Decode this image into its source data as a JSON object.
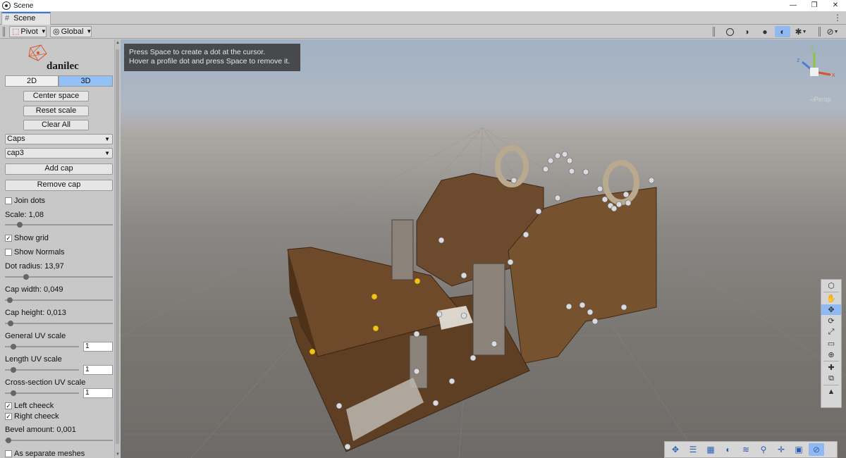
{
  "window": {
    "title": "Scene",
    "controls": [
      "—",
      "❐",
      "✕"
    ]
  },
  "tab": {
    "label": "Scene",
    "menu": "⋮"
  },
  "toolbar": {
    "pivot_label": "Pivot",
    "global_label": "Global",
    "right_icons": [
      "globe-icon",
      "shading-icon",
      "sphere-icon",
      "lighting-icon",
      "bug-icon",
      "gizmo-icon"
    ]
  },
  "panel": {
    "logo_text": "danilec",
    "mode_2d": "2D",
    "mode_3d": "3D",
    "active_mode": "3D",
    "center_space": "Center space",
    "reset_scale": "Reset scale",
    "clear_all": "Clear All",
    "category_dropdown": "Caps",
    "item_dropdown": "cap3",
    "add_cap": "Add cap",
    "remove_cap": "Remove cap",
    "join_dots": {
      "label": "Join dots",
      "checked": false
    },
    "scale": {
      "label": "Scale: 1,08",
      "fraction": 0.12
    },
    "show_grid": {
      "label": "Show grid",
      "checked": true
    },
    "show_normals": {
      "label": "Show Normals",
      "checked": false
    },
    "dot_radius": {
      "label": "Dot radius: 13,97",
      "fraction": 0.18
    },
    "cap_width": {
      "label": "Cap width: 0,049",
      "fraction": 0.02
    },
    "cap_height": {
      "label": "Cap height: 0,013",
      "fraction": 0.03
    },
    "general_uv": {
      "label": "General UV scale",
      "value": "1",
      "fraction": 0.08
    },
    "length_uv": {
      "label": "Length UV scale",
      "value": "1",
      "fraction": 0.08
    },
    "cross_uv": {
      "label": "Cross-section UV scale",
      "value": "1",
      "fraction": 0.08
    },
    "left_cheeck": {
      "label": "Left cheeck",
      "checked": true
    },
    "right_cheeck": {
      "label": "Right cheeck",
      "checked": true
    },
    "bevel": {
      "label": "Bevel amount: 0,001",
      "fraction": 0.01
    },
    "separate_meshes": {
      "label": "As separate meshes",
      "checked": false
    }
  },
  "viewport": {
    "hint_line1": "Press Space to create a dot at the cursor.",
    "hint_line2": "Hover a profile dot and press Space to remove it.",
    "gizmo_label": "◅Persp",
    "gizmo_axes": {
      "x": "x",
      "y": "y",
      "z": "z"
    },
    "tool_icons": [
      "view-icon",
      "hand-icon",
      "move-icon",
      "rotate-icon",
      "scale-icon",
      "rect-icon",
      "transform-icon",
      "custom-tool-icon",
      "snap-icon",
      "paint-icon"
    ],
    "active_tool": "move-icon",
    "bottom_icons": [
      "move-icon",
      "align-icon",
      "grid-icon",
      "sphere-icon",
      "layers-icon",
      "search-icon",
      "pan-icon",
      "camera-icon",
      "compass-icon"
    ]
  },
  "colors": {
    "accent": "#3a79d5",
    "active_button": "#93c0f5",
    "sky": "#a2b1c4",
    "ground": "#7a7672",
    "wood": "#6b4a2e",
    "dot_white": "#d9dbe0",
    "dot_yellow": "#f2c21b"
  }
}
